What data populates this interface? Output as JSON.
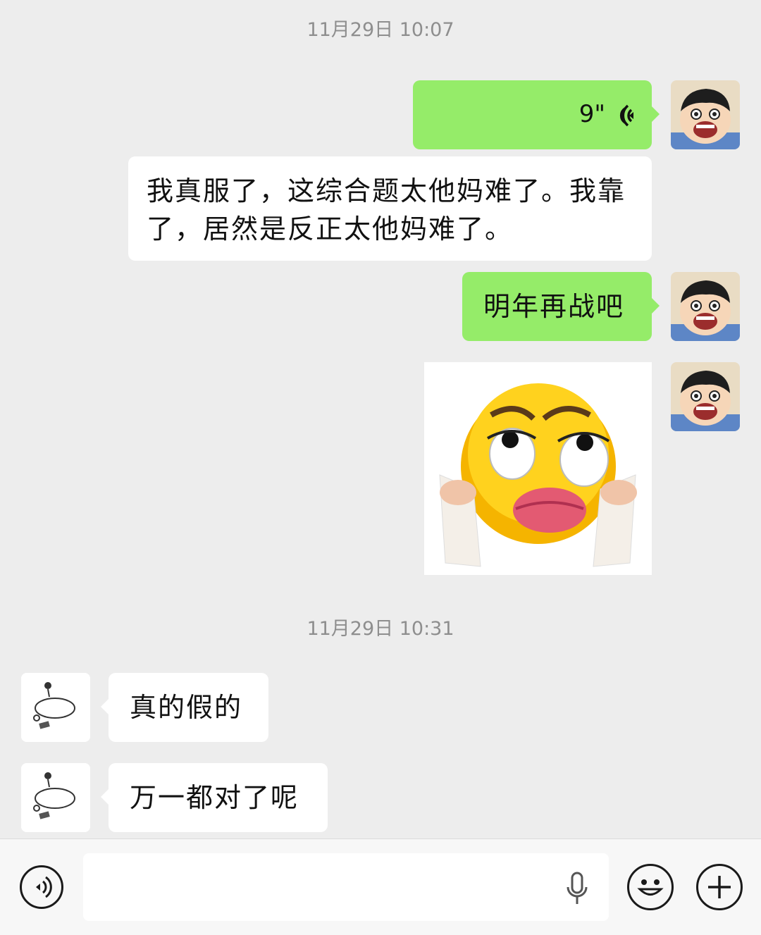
{
  "timestamps": [
    "11月29日 10:07",
    "11月29日 10:31"
  ],
  "messages": {
    "voice_duration": "9\"",
    "text1_line1": "我真服了，这综合题太他妈难了。我靠",
    "text1_line2": "了，居然是反正太他妈难了。",
    "mine1": "明年再战吧",
    "peer1": "真的假的",
    "peer2": "万一都对了呢"
  },
  "input": {
    "placeholder": ""
  },
  "colors": {
    "background": "#ededed",
    "my_bubble": "#95ec69",
    "peer_bubble": "#ffffff",
    "timestamp": "#8e8e8e"
  },
  "icons": {
    "voice_toggle": "voice-mode-icon",
    "mic": "microphone-icon",
    "emoji": "emoji-icon",
    "more": "plus-icon",
    "voice_wave": "voice-wave-icon"
  }
}
